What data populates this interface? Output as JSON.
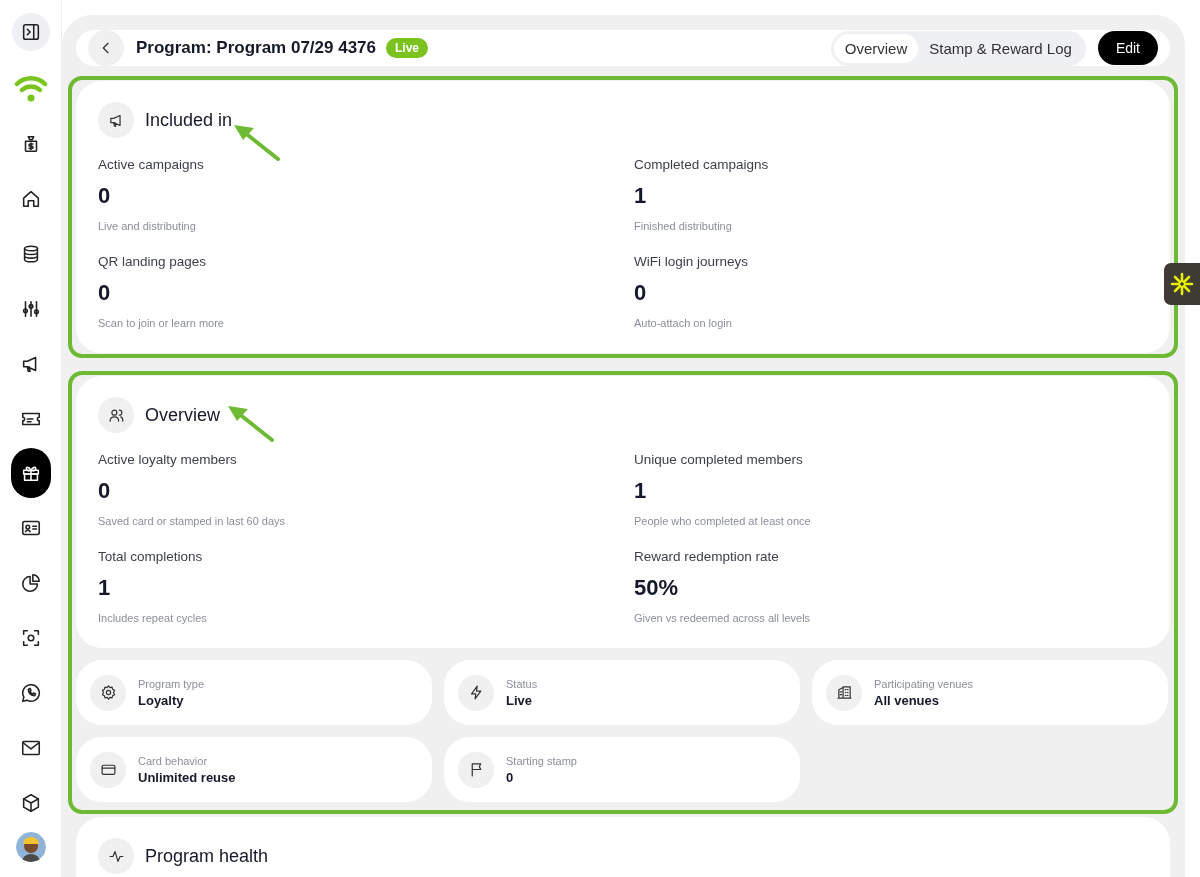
{
  "sidebar": {
    "items": [
      {
        "selected": false
      },
      {
        "selected": false
      },
      {
        "selected": false
      },
      {
        "selected": false
      },
      {
        "selected": false
      },
      {
        "selected": false
      },
      {
        "selected": false
      },
      {
        "selected": false
      },
      {
        "selected": true
      },
      {
        "selected": false
      },
      {
        "selected": false
      },
      {
        "selected": false
      },
      {
        "selected": false
      },
      {
        "selected": false
      },
      {
        "selected": false
      }
    ]
  },
  "header": {
    "title": "Program: Program 07/29 4376",
    "badge": "Live",
    "tabs": [
      {
        "label": "Overview",
        "selected": true
      },
      {
        "label": "Stamp & Reward Log",
        "selected": false
      }
    ],
    "edit_button": "Edit"
  },
  "sections": [
    {
      "title": "Included in",
      "stats": [
        {
          "label": "Active campaigns",
          "value": "0",
          "note": "Live and distributing"
        },
        {
          "label": "Completed campaigns",
          "value": "1",
          "note": "Finished distributing"
        },
        {
          "label": "QR landing pages",
          "value": "0",
          "note": "Scan to join or learn more"
        },
        {
          "label": "WiFi login journeys",
          "value": "0",
          "note": "Auto-attach on login"
        }
      ]
    },
    {
      "title": "Overview",
      "stats": [
        {
          "label": "Active loyalty members",
          "value": "0",
          "note": "Saved card or stamped in last 60 days"
        },
        {
          "label": "Unique completed members",
          "value": "1",
          "note": "People who completed at least once"
        },
        {
          "label": "Total completions",
          "value": "1",
          "note": "Includes repeat cycles"
        },
        {
          "label": "Reward redemption rate",
          "value": "50%",
          "note": "Given vs redeemed across all levels"
        }
      ],
      "details": [
        {
          "label": "Program type",
          "value": "Loyalty"
        },
        {
          "label": "Status",
          "value": "Live"
        },
        {
          "label": "Participating venues",
          "value": "All venues"
        },
        {
          "label": "Card behavior",
          "value": "Unlimited reuse"
        },
        {
          "label": "Starting stamp",
          "value": "0"
        }
      ]
    }
  ],
  "health": {
    "title": "Program health"
  }
}
